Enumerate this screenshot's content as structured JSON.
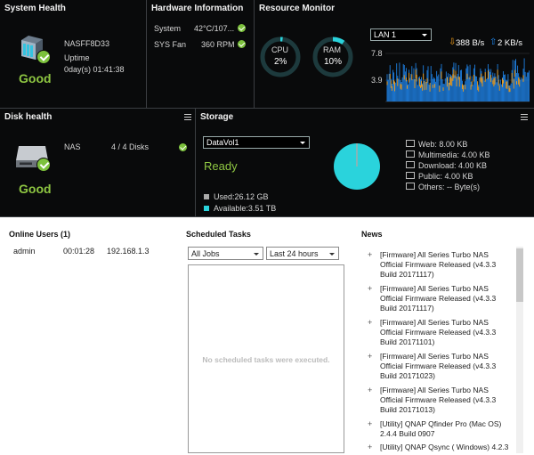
{
  "system_health": {
    "title": "System Health",
    "host": "NASFF8D33",
    "uptime_label": "Uptime",
    "uptime_value": "0day(s) 01:41:38",
    "status": "Good"
  },
  "hardware": {
    "title": "Hardware Information",
    "rows": [
      {
        "label": "System",
        "value": "42°C/107..."
      },
      {
        "label": "SYS Fan",
        "value": "360 RPM"
      }
    ]
  },
  "resource": {
    "title": "Resource Monitor",
    "cpu_label": "CPU",
    "cpu_value": "2%",
    "cpu_percent": 2,
    "ram_label": "RAM",
    "ram_value": "10%",
    "ram_percent": 10,
    "lan_select": "LAN 1",
    "down_rate": "388 B/s",
    "up_rate": "2 KB/s",
    "y_high": "7.8",
    "y_low": "3.9"
  },
  "disk_health": {
    "title": "Disk health",
    "name": "NAS",
    "disks": "4 / 4 Disks",
    "status": "Good"
  },
  "storage": {
    "title": "Storage",
    "volume_select": "DataVol1",
    "state": "Ready",
    "used": "Used:26.12 GB",
    "available": "Available:3.51 TB",
    "folders": [
      "Web: 8.00 KB",
      "Multimedia: 4.00 KB",
      "Download: 4.00 KB",
      "Public: 4.00 KB",
      "Others: -- Byte(s)"
    ],
    "colors": {
      "used": "#aaaaaa",
      "available": "#2ad3dc"
    }
  },
  "online_users": {
    "title": "Online Users (1)",
    "rows": [
      {
        "user": "admin",
        "time": "00:01:28",
        "ip": "192.168.1.3"
      }
    ]
  },
  "scheduled": {
    "title": "Scheduled Tasks",
    "job_select": "All Jobs",
    "period_select": "Last 24 hours",
    "empty_message": "No scheduled tasks were executed."
  },
  "news": {
    "title": "News",
    "items": [
      "[Firmware] All Series Turbo NAS Official Firmware Released (v4.3.3 Build 20171117)",
      "[Firmware] All Series Turbo NAS Official Firmware Released (v4.3.3 Build 20171117)",
      "[Firmware] All Series Turbo NAS Official Firmware Released (v4.3.3 Build 20171101)",
      "[Firmware] All Series Turbo NAS Official Firmware Released (v4.3.3 Build 20171023)",
      "[Firmware] All Series Turbo NAS Official Firmware Released (v4.3.3 Build 20171013)",
      "[Utility] QNAP Qfinder Pro (Mac OS) 2.4.4 Build 0907",
      "[Utility] QNAP Qsync ( Windows) 4.2.3"
    ]
  }
}
